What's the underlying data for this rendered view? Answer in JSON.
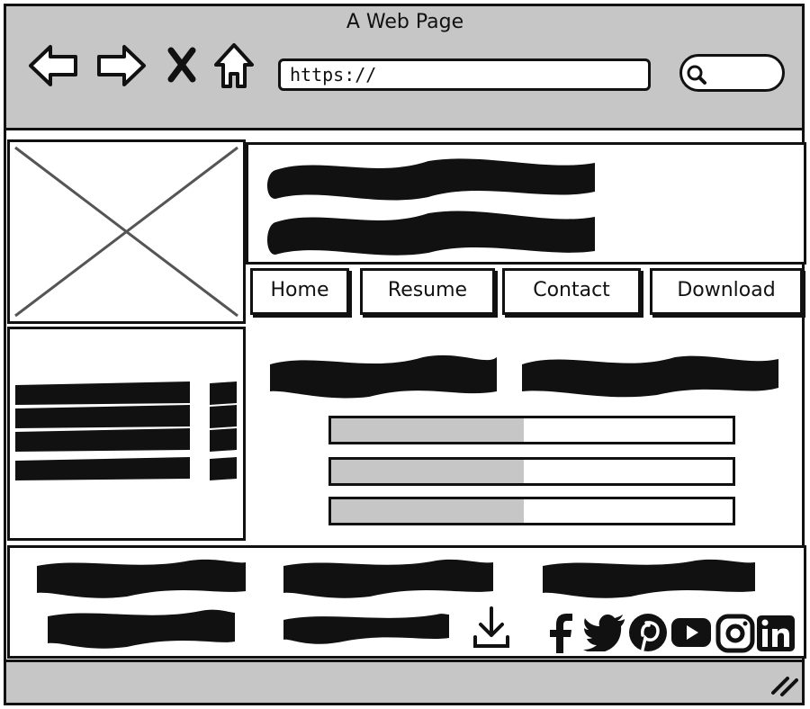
{
  "window": {
    "title": "A Web Page"
  },
  "toolbar": {
    "back_icon": "back-arrow-icon",
    "forward_icon": "forward-arrow-icon",
    "stop_icon": "close-icon",
    "home_icon": "home-icon"
  },
  "address": {
    "value": "https://"
  },
  "search": {
    "icon": "search-icon",
    "value": ""
  },
  "nav": {
    "items": [
      {
        "label": "Home"
      },
      {
        "label": "Resume"
      },
      {
        "label": "Contact"
      },
      {
        "label": "Download"
      }
    ]
  },
  "skills": {
    "bars": [
      {
        "level": 0.48
      },
      {
        "level": 0.48
      },
      {
        "level": 0.48
      }
    ]
  },
  "footer": {
    "download_icon": "download-icon",
    "social_icons": [
      "facebook-icon",
      "twitter-icon",
      "pinterest-icon",
      "youtube-icon",
      "instagram-icon",
      "linkedin-icon"
    ]
  },
  "colors": {
    "chrome": "#c6c6c6",
    "ink": "#111111",
    "placeholder_x": "#555555"
  }
}
